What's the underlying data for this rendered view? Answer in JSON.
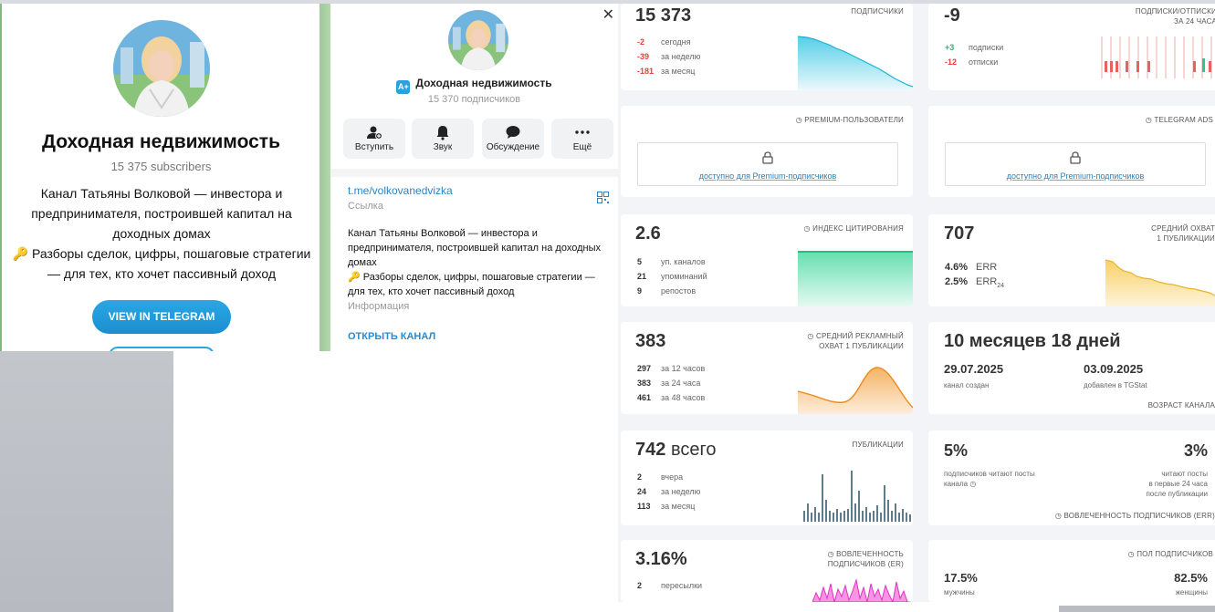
{
  "web_preview": {
    "title": "Доходная недвижимость",
    "subscribers": "15 375 subscribers",
    "description_line1": "Канал Татьяны Волковой — инвестора и предпринимателя, построившей капитал на доходных домах",
    "description_line2": "🔑 Разборы сделок, цифры, пошаговые стратегии — для тех, кто хочет пассивный доход",
    "view_button": "VIEW IN TELEGRAM"
  },
  "channel_info": {
    "name": "Доходная недвижимость",
    "subscribers": "15 370 подписчиков",
    "actions": [
      {
        "label": "Вступить",
        "icon": "join-icon"
      },
      {
        "label": "Звук",
        "icon": "bell-icon"
      },
      {
        "label": "Обсуждение",
        "icon": "chat-icon"
      },
      {
        "label": "Ещё",
        "icon": "more-icon"
      }
    ],
    "link": "t.me/volkovanedvizka",
    "link_label": "Ссылка",
    "description_line1": "Канал Татьяны Волковой — инвестора и предпринимателя, построившей капитал на доходных домах",
    "description_line2": "🔑 Разборы сделок, цифры, пошаговые стратегии — для тех, кто хочет пассивный доход",
    "description_label": "Информация",
    "open_button": "ОТКРЫТЬ КАНАЛ"
  },
  "stats": {
    "subscribers": {
      "value": "15 373",
      "label": "ПОДПИСЧИКИ",
      "rows": [
        {
          "v": "-2",
          "t": "сегодня"
        },
        {
          "v": "-39",
          "t": "за неделю"
        },
        {
          "v": "-181",
          "t": "за месяц"
        }
      ]
    },
    "change24": {
      "value": "-9",
      "label": "ПОДПИСКИ/ОТПИСКИ",
      "label2": "ЗА 24 ЧАСА",
      "rows": [
        {
          "v": "+3",
          "t": "подписки"
        },
        {
          "v": "-12",
          "t": "отписки"
        }
      ]
    },
    "premium": {
      "label": "PREMIUM-ПОЛЬЗОВАТЕЛИ",
      "lock_text": "доступно для Premium-подписчиков"
    },
    "ads": {
      "label": "TELEGRAM ADS",
      "lock_text": "доступно для Premium-подписчиков"
    },
    "citation": {
      "value": "2.6",
      "label": "ИНДЕКС ЦИТИРОВАНИЯ",
      "rows": [
        {
          "v": "5",
          "t": "уп. каналов"
        },
        {
          "v": "21",
          "t": "упоминаний"
        },
        {
          "v": "9",
          "t": "репостов"
        }
      ]
    },
    "reach": {
      "value": "707",
      "label": "СРЕДНИЙ ОХВАТ",
      "label2": "1 ПУБЛИКАЦИИ",
      "err": "4.6%",
      "err_label": "ERR",
      "err24": "2.5%",
      "err24_label": "ERR",
      "err24_sub": "24"
    },
    "ad_reach": {
      "value": "383",
      "label": "СРЕДНИЙ РЕКЛАМНЫЙ",
      "label2": "ОХВАТ 1 ПУБЛИКАЦИИ",
      "rows": [
        {
          "v": "297",
          "t": "за 12 часов"
        },
        {
          "v": "383",
          "t": "за 24 часа"
        },
        {
          "v": "461",
          "t": "за 48 часов"
        }
      ]
    },
    "age": {
      "value": "10 месяцев 18 дней",
      "created": "29.07.2025",
      "created_label": "канал создан",
      "added": "03.09.2025",
      "added_label": "добавлен в TGStat",
      "label": "ВОЗРАСТ КАНАЛА"
    },
    "posts": {
      "value": "742",
      "value_suffix": "всего",
      "label": "ПУБЛИКАЦИИ",
      "rows": [
        {
          "v": "2",
          "t": "вчера"
        },
        {
          "v": "24",
          "t": "за неделю"
        },
        {
          "v": "113",
          "t": "за месяц"
        }
      ]
    },
    "engagement": {
      "left": "5%",
      "left_label": "подписчиков читают посты канала",
      "right": "3%",
      "right_label1": "читают посты",
      "right_label2": "в первые 24 часа",
      "right_label3": "после публикации",
      "label": "ВОВЛЕЧЕННОСТЬ ПОДПИСЧИКОВ (ERR)"
    },
    "er": {
      "value": "3.16%",
      "label": "ВОВЛЕЧЕННОСТЬ",
      "label2": "ПОДПИСЧИКОВ (ER)",
      "rows": [
        {
          "v": "2",
          "t": "пересылки"
        }
      ]
    },
    "gender": {
      "label": "ПОЛ ПОДПИСЧИКОВ",
      "male": "17.5%",
      "male_label": "мужчины",
      "female": "82.5%",
      "female_label": "женщины"
    }
  },
  "colors": {
    "accent": "#2aa7e3",
    "subs_chart": "#38c6e3",
    "citation_chart": "#52dba6",
    "reach_chart": "#f6c84a",
    "ad_reach_chart": "#f3a64a",
    "posts_chart": "#5e7c8a",
    "er_chart": "#f04fd1",
    "negative": "#e2413d",
    "positive": "#1fb872"
  }
}
